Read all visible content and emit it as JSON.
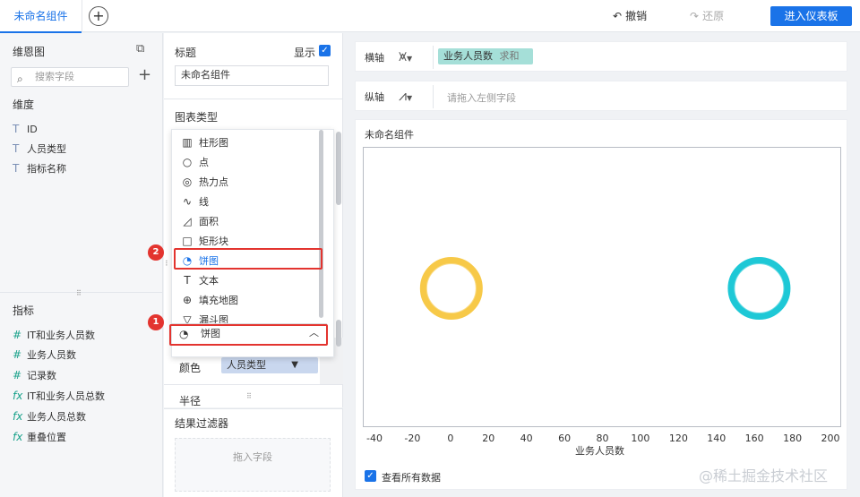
{
  "topbar": {
    "tab_label": "未命名组件",
    "add_tab": "+",
    "undo_label": "撤销",
    "redo_label": "还原",
    "enter_dashboard_label": "进入仪表板"
  },
  "left": {
    "title": "维恩图",
    "search_placeholder": "搜索字段",
    "add": "+",
    "dimensions_title": "维度",
    "dimensions": [
      {
        "icon": "T",
        "label": "ID"
      },
      {
        "icon": "T",
        "label": "人员类型"
      },
      {
        "icon": "T",
        "label": "指标名称"
      }
    ],
    "metrics_title": "指标",
    "metrics": [
      {
        "icon": "#",
        "label": "IT和业务人员数"
      },
      {
        "icon": "#",
        "label": "业务人员数"
      },
      {
        "icon": "#",
        "label": "记录数"
      },
      {
        "icon": "fx",
        "label": "IT和业务人员总数"
      },
      {
        "icon": "fx",
        "label": "业务人员总数"
      },
      {
        "icon": "fx",
        "label": "重叠位置"
      }
    ]
  },
  "mid": {
    "title_label": "标题",
    "show_label": "显示",
    "title_value": "未命名组件",
    "chart_type_label": "图表类型",
    "chart_types": [
      {
        "icon": "bar-chart-icon",
        "glyph": "▥",
        "label": "柱形图"
      },
      {
        "icon": "dot-icon",
        "glyph": "○",
        "label": "点"
      },
      {
        "icon": "heat-point-icon",
        "glyph": "◎",
        "label": "热力点"
      },
      {
        "icon": "line-icon",
        "glyph": "∿",
        "label": "线"
      },
      {
        "icon": "area-icon",
        "glyph": "◿",
        "label": "面积"
      },
      {
        "icon": "rect-icon",
        "glyph": "□",
        "label": "矩形块"
      },
      {
        "icon": "pie-icon",
        "glyph": "◔",
        "label": "饼图"
      },
      {
        "icon": "text-icon",
        "glyph": "T",
        "label": "文本"
      },
      {
        "icon": "fill-map-icon",
        "glyph": "⊕",
        "label": "填充地图"
      },
      {
        "icon": "funnel-icon",
        "glyph": "▽",
        "label": "漏斗图"
      }
    ],
    "selected_type": "饼图",
    "color_label": "颜色",
    "color_field": "人员类型",
    "radius_label": "半径",
    "filter_title": "结果过滤器",
    "filter_hint": "拖入字段",
    "badge_1": "1",
    "badge_2": "2"
  },
  "axes": {
    "x_label": "横轴",
    "x_field": "业务人员数",
    "x_agg": "求和",
    "y_label": "纵轴",
    "y_hint": "请拖入左侧字段"
  },
  "chart": {
    "title": "未命名组件",
    "show_all_label": "查看所有数据",
    "watermark": "@稀土掘金技术社区"
  },
  "colors": {
    "accent": "#1a73e8",
    "ring_yellow": "#f7c948",
    "ring_teal": "#1ec8d6",
    "highlight": "#e3342f"
  },
  "chart_data": {
    "type": "scatter",
    "xlabel": "业务人员数",
    "ylabel": "",
    "xlim": [
      -40,
      200
    ],
    "x_ticks": [
      "-40",
      "-20",
      "0",
      "20",
      "40",
      "60",
      "80",
      "100",
      "120",
      "140",
      "160",
      "180",
      "200"
    ],
    "series": [
      {
        "x": 0,
        "color": "#f7c948"
      },
      {
        "x": 162,
        "color": "#1ec8d6"
      }
    ]
  }
}
